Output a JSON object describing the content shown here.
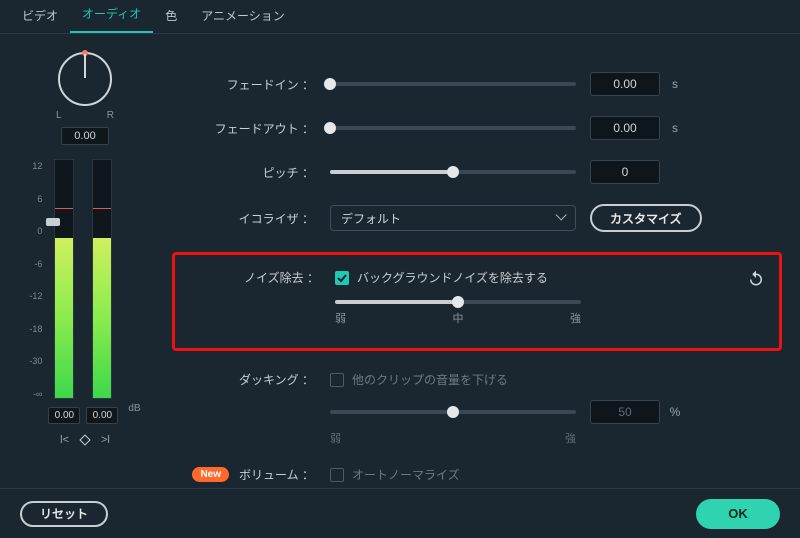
{
  "tabs": {
    "video": "ビデオ",
    "audio": "オーディオ",
    "color": "色",
    "animation": "アニメーション"
  },
  "pan": {
    "L": "L",
    "R": "R",
    "value": "0.00"
  },
  "meter": {
    "scale": [
      "12",
      "6",
      "0",
      "-6",
      "-12",
      "-18",
      "-30",
      "-∞"
    ],
    "left": "0.00",
    "right": "0.00",
    "db": "dB"
  },
  "keyctrl": {
    "prev": "l<",
    "next": ">l"
  },
  "form": {
    "fadein": {
      "label": "フェードイン ：",
      "value": "0.00",
      "unit": "s"
    },
    "fadeout": {
      "label": "フェードアウト ：",
      "value": "0.00",
      "unit": "s"
    },
    "pitch": {
      "label": "ピッチ ：",
      "value": "0"
    },
    "eq": {
      "label": "イコライザ ：",
      "selected": "デフォルト",
      "customize": "カスタマイズ"
    },
    "noise": {
      "label": "ノイズ除去 ：",
      "check": "バックグラウンドノイズを除去する",
      "ticks": {
        "low": "弱",
        "mid": "中",
        "high": "強"
      }
    },
    "ducking": {
      "label": "ダッキング ：",
      "check": "他のクリップの音量を下げる",
      "value": "50",
      "unit": "%",
      "ticks": {
        "low": "弱",
        "high": "強"
      }
    },
    "volume": {
      "badge": "New",
      "label": "ボリューム ：",
      "check": "オートノーマライズ"
    }
  },
  "footer": {
    "reset": "リセット",
    "ok": "OK"
  }
}
